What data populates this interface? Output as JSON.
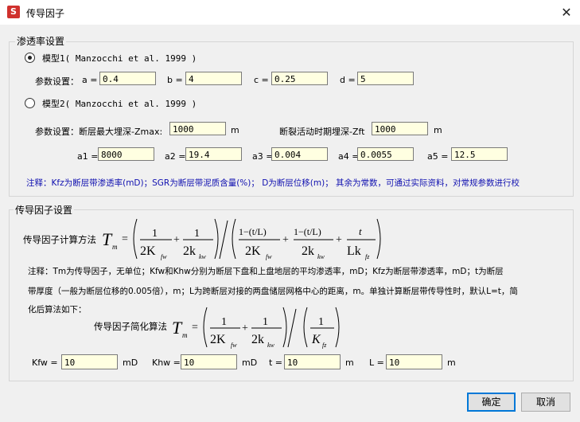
{
  "window": {
    "title": "传导因子",
    "icon_text": "S"
  },
  "permeability": {
    "group_label": "渗透率设置",
    "model1": {
      "label": "模型1( Manzocchi et al. 1999 )",
      "checked": true
    },
    "params_label": "参数设置：",
    "a_label": "a =",
    "a_value": "0.4",
    "b_label": "b =",
    "b_value": "4",
    "c_label": "c =",
    "c_value": "0.25",
    "d_label": "d =",
    "d_value": "5",
    "model2": {
      "label": "模型2( Manzocchi et al. 1999 )",
      "checked": false
    },
    "params2_label": "参数设置：断层最大埋深-Zmax:",
    "zmax_value": "1000",
    "zmax_unit": "m",
    "zft_label": "断裂活动时期埋深-Zft",
    "zft_value": "1000",
    "zft_unit": "m",
    "a1_label": "a1 =",
    "a1_value": "8000",
    "a2_label": "a2 =",
    "a2_value": "19.4",
    "a3_label": "a3 =",
    "a3_value": "0.004",
    "a4_label": "a4 =",
    "a4_value": "0.0055",
    "a5_label": "a5 =",
    "a5_value": "12.5",
    "note": "注释：Kfz为断层带渗透率(mD)；SGR为断层带泥质含量(%)；  D为断层位移(m)；  其余为常数，可通过实际资料，对常规参数进行校"
  },
  "transmissibility": {
    "group_label": "传导因子设置",
    "method_label": "传导因子计算方法",
    "note_line1": "注释：Tm为传导因子，无单位；Kfw和Khw分别为断层下盘和上盘地层的平均渗透率，mD；Kfz为断层带渗透率，mD；t为断层",
    "note_line2": "带厚度（一般为断层位移的0.005倍），m；L为跨断层对接的两盘储层网格中心的距离，m。单独计算断层带传导性时，默认L=t，简",
    "note_line3": "化后算法如下：",
    "simplified_label": "传导因子简化算法",
    "kfw_label": "Kfw =",
    "kfw_value": "10",
    "kfw_unit": "mD",
    "khw_label": "Khw =",
    "khw_value": "10",
    "khw_unit": "mD",
    "t_label": "t =",
    "t_value": "10",
    "t_unit": "m",
    "l_label": "L =",
    "l_value": "10",
    "l_unit": "m"
  },
  "buttons": {
    "ok": "确定",
    "cancel": "取消"
  }
}
